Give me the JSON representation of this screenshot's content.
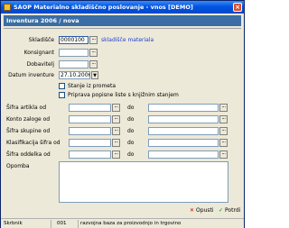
{
  "window": {
    "title": "SAOP Materialno skladiščno poslovanje - vnos [DEMO]",
    "close_glyph": "×"
  },
  "subheader": {
    "title": "Inventura 2006 / nova"
  },
  "form": {
    "skladisce": {
      "label": "Skladišče",
      "value": "0000100",
      "description": "skladišče materiala"
    },
    "konsignant": {
      "label": "Konsignant",
      "value": ""
    },
    "dobavitelj": {
      "label": "Dobavitelj",
      "value": ""
    },
    "datum": {
      "label": "Datum inventure",
      "value": "27.10.2006"
    },
    "checkboxes": [
      {
        "label": "Stanje iz prometa",
        "checked": false
      },
      {
        "label": "Priprava popisne liste s knjižnim stanjem",
        "checked": false
      }
    ],
    "range_to_label": "do",
    "ranges": [
      {
        "label": "Šifra artikla od",
        "from": "",
        "to": ""
      },
      {
        "label": "Konto zaloge od",
        "from": "",
        "to": ""
      },
      {
        "label": "Šifra skupine od",
        "from": "",
        "to": ""
      },
      {
        "label": "Klasifikacija šifra od",
        "from": "",
        "to": ""
      },
      {
        "label": "Šifra oddelka od",
        "from": "",
        "to": ""
      }
    ],
    "opomba": {
      "label": "Opomba",
      "value": ""
    },
    "lookup_glyph": "...",
    "dropdown_glyph": "▼"
  },
  "buttons": {
    "cancel": {
      "label": "Opusti",
      "icon": "x-icon",
      "color": "#c00000"
    },
    "confirm": {
      "label": "Potrdi",
      "icon": "check-icon",
      "color": "#008000"
    }
  },
  "statusbar": {
    "field": "Skrbnik",
    "code": "001",
    "description": "razvojna baza za proizvodnjo in trgovino"
  }
}
